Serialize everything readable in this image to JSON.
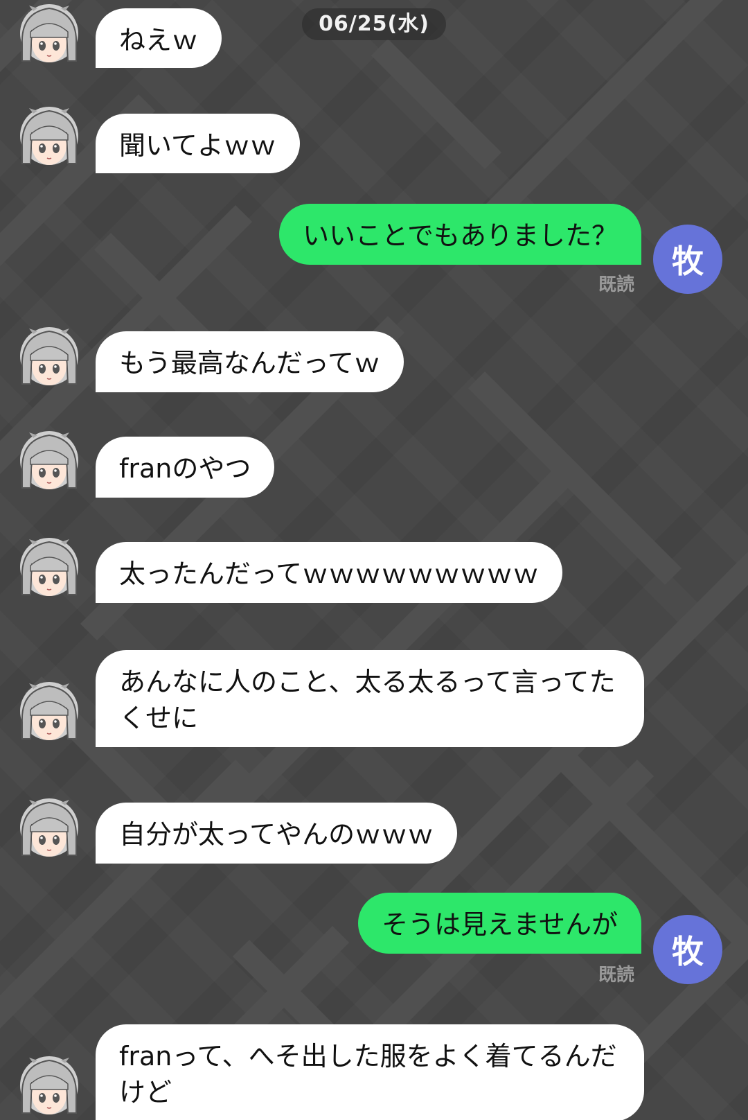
{
  "chat": {
    "date": "06/25(水)",
    "read_label": "既読",
    "my_avatar_char": "牧",
    "messages": [
      {
        "from": "other",
        "text": "ねえｗ"
      },
      {
        "from": "other",
        "text": "聞いてよｗｗ"
      },
      {
        "from": "me",
        "text": "いいことでもありました？",
        "status": "既読"
      },
      {
        "from": "other",
        "text": "もう最高なんだってｗ"
      },
      {
        "from": "other",
        "text": "franのやつ"
      },
      {
        "from": "other",
        "text": "太ったんだってｗｗｗｗｗｗｗｗｗ"
      },
      {
        "from": "other",
        "text": "あんなに人のこと、太る太るって言ってたくせに"
      },
      {
        "from": "other",
        "text": "自分が太ってやんのｗｗｗ"
      },
      {
        "from": "me",
        "text": "そうは見えませんが",
        "status": "既読"
      },
      {
        "from": "other",
        "text": "franって、へそ出した服をよく着てるんだけど"
      }
    ]
  },
  "colors": {
    "background": "#474747",
    "incoming_bubble": "#ffffff",
    "outgoing_bubble": "#2de76a",
    "my_avatar": "#6673d9",
    "read_text": "#9a9a9a"
  },
  "icons": {
    "other_avatar": "gray-haired-anime-girl-avatar-icon"
  }
}
